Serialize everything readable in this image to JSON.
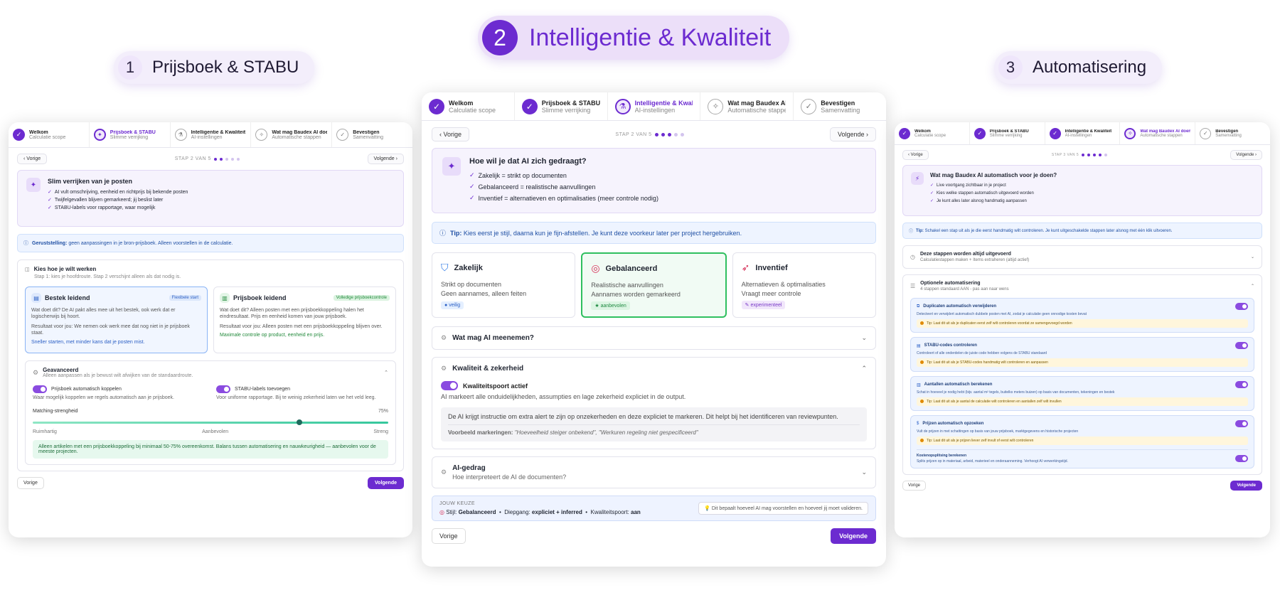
{
  "headers": {
    "one": {
      "num": "1",
      "label": "Prijsboek & STABU"
    },
    "two": {
      "num": "2",
      "label": "Intelligentie & Kwaliteit"
    },
    "three": {
      "num": "3",
      "label": "Automatisering"
    }
  },
  "steps": [
    {
      "title": "Welkom",
      "sub": "Calculatie scope"
    },
    {
      "title": "Prijsboek & STABU",
      "sub": "Slimme verrijking"
    },
    {
      "title": "Intelligentie & Kwaliteit",
      "sub": "AI-instellingen"
    },
    {
      "title": "Wat mag Baudex AI doen?",
      "sub": "Automatische stappen"
    },
    {
      "title": "Bevestigen",
      "sub": "Samenvatting"
    }
  ],
  "nav": {
    "prev": "Vorige",
    "next": "Volgende",
    "step_label": "STAP 2 VAN 5",
    "step3_label": "STAP 3 VAN 5"
  },
  "left": {
    "hero_title": "Slim verrijken van je posten",
    "hero_items": [
      "AI vult omschrijving, eenheid en richtprijs bij bekende posten",
      "Twijfelgevallen blijven gemarkeerd; jij beslist later",
      "STABU-labels voor rapportage, waar mogelijk"
    ],
    "tip_bold": "Geruststelling:",
    "tip_text": " geen aanpassingen in je bron-prijsboek. Alleen voorstellen in de calculatie.",
    "choose_title": "Kies hoe je wilt werken",
    "choose_sub": "Stap 1: kies je hoofdroute. Stap 2 verschijnt alleen als dat nodig is.",
    "opt1": {
      "title": "Bestek leidend",
      "badge": "Flexibele start",
      "l1": "Wat doet dit? De AI pakt alles mee uit het bestek, ook werk dat er logischerwijs bij hoort.",
      "l2": "Resultaat voor jou: We nemen ook werk mee dat nog niet in je prijsboek staat.",
      "link": "Sneller starten, met minder kans dat je posten mist."
    },
    "opt2": {
      "title": "Prijsboek leidend",
      "badge": "Volledige prijsboekcontrole",
      "l1": "Wat doet dit? Alleen posten met een prijsboekkoppeling halen het eindresultaat. Prijs en eenheid komen van jouw prijsboek.",
      "l2": "Resultaat voor jou: Alleen posten met een prijsboekkoppeling blijven over.",
      "link": "Maximale controle op product, eenheid en prijs."
    },
    "adv_title": "Geavanceerd",
    "adv_sub": "Alleen aanpassen als je bewust wilt afwijken van de standaardroute.",
    "t1": {
      "title": "Prijsboek automatisch koppelen",
      "sub": "Waar mogelijk koppelen we regels automatisch aan je prijsboek."
    },
    "t2": {
      "title": "STABU-labels toevoegen",
      "sub": "Voor uniforme rapportage. Bij te weinig zekerheid laten we het veld leeg."
    },
    "match_label": "Matching-strengheid",
    "match_value": "75%",
    "match_fraction": 0.75,
    "match_scale": [
      "Ruimhartig",
      "Aanbevolen",
      "Streng"
    ],
    "green_note": "Alleen artikelen met een prijsboekkoppeling bij minimaal 50-75% overeenkomst. Balans tussen automatisering en nauwkeurigheid — aanbevolen voor de meeste projecten."
  },
  "mid": {
    "hero_title": "Hoe wil je dat AI zich gedraagt?",
    "hero_items": [
      "Zakelijk = strikt op documenten",
      "Gebalanceerd = realistische aanvullingen",
      "Inventief = alternatieven en optimalisaties (meer controle nodig)"
    ],
    "tip_bold": "Tip:",
    "tip_text": " Kies eerst je stijl, daarna kun je fijn-afstellen. Je kunt deze voorkeur later per project hergebruiken.",
    "styles": [
      {
        "title": "Zakelijk",
        "l1": "Strikt op documenten",
        "l2": "Geen aannames, alleen feiten",
        "badge": "veilig"
      },
      {
        "title": "Gebalanceerd",
        "l1": "Realistische aanvullingen",
        "l2": "Aannames worden gemarkeerd",
        "badge": "aanbevolen"
      },
      {
        "title": "Inventief",
        "l1": "Alternatieven & optimalisaties",
        "l2": "Vraagt meer controle",
        "badge": "experimenteel"
      }
    ],
    "acc1": "Wat mag AI meenemen?",
    "acc2": "Kwaliteit & zekerheid",
    "gate_title": "Kwaliteitspoort actief",
    "gate_sub": "AI markeert alle onduidelijkheden, assumpties en lage zekerheid expliciet in de output.",
    "gate_box": "De AI krijgt instructie om extra alert te zijn op onzekerheden en deze expliciet te markeren. Dit helpt bij het identificeren van reviewpunten.",
    "gate_ex_bold": "Voorbeeld markeringen:",
    "gate_ex": " \"Hoeveelheid steiger onbekend\", \"Werkuren regeling niet gespecificeerd\"",
    "acc3_title": "AI-gedrag",
    "acc3_sub": "Hoe interpreteert de AI de documenten?",
    "choice_label": "JOUW KEUZE",
    "choice_style_k": "Stijl:",
    "choice_style_v": "Gebalanceerd",
    "choice_depth_k": "Diepgang:",
    "choice_depth_v": "expliciet + inferred",
    "choice_gate_k": "Kwaliteitspoort:",
    "choice_gate_v": "aan",
    "choice_hint": "Dit bepaalt hoeveel AI mag voorstellen en hoeveel jij moet valideren."
  },
  "right": {
    "hero_title": "Wat mag Baudex AI automatisch voor je doen?",
    "hero_items": [
      "Live voortgang zichtbaar in je project",
      "Kies welke stappen automatisch uitgevoerd worden",
      "Je kunt alles later alsnog handmatig aanpassen"
    ],
    "tip_bold": "Tip:",
    "tip_text": " Schakel een stap uit als je die eerst handmatig wilt controleren. Je kunt uitgeschakelde stappen later alsnog met één klik uitvoeren.",
    "always_title": "Deze stappen worden altijd uitgevoerd",
    "always_sub": "Calculatiestappen maken + Items extraheren (altijd actief)",
    "opt_title": "Optionele automatisering",
    "opt_sub": "4 stappen standaard AAN - pas aan naar wens",
    "items": [
      {
        "title": "Duplicaten automatisch verwijderen",
        "sub": "Detecteert en verwijdert automatisch dubbele posten met AI, zodat je calculatie geen onnodige kosten bevat",
        "tip": "Tip: Laat dit uit als je duplicaten eerst zelf wilt controleren voordat ze samengevoegd worden"
      },
      {
        "title": "STABU-codes controleren",
        "sub": "Controleert of alle onderdelen de juiste code hebben volgens de STABU standaard",
        "tip": "Tip: Laat dit uit als je STABU-codes handmatig wilt controleren en aanpassen"
      },
      {
        "title": "Aantallen automatisch berekenen",
        "sub": "Schat in hoeveel je nodig hebt (bijv. aantal m² tegels, buitelks meters buizen) op basis van documenten, tekeningen en bestek",
        "tip": "Tip: Laat dit uit als je aantal de calculatie wilt controleren en aantallen zelf wilt invullen"
      },
      {
        "title": "Prijzen automatisch opzoeken",
        "sub": "Vult de prijzen in met schattingen op basis van jouw prijsboek, marktgegevens en historische projecten",
        "tip": "Tip: Laat dit uit als je prijzen liever zelf invult of eerst wilt controleren"
      }
    ],
    "last": {
      "title": "Kostenopsplitsing berekenen",
      "sub": "Splits prijzen op in materiaal, arbeid, materieel en onderaanneming. Verhoogt AI verwerkingstijd."
    }
  }
}
